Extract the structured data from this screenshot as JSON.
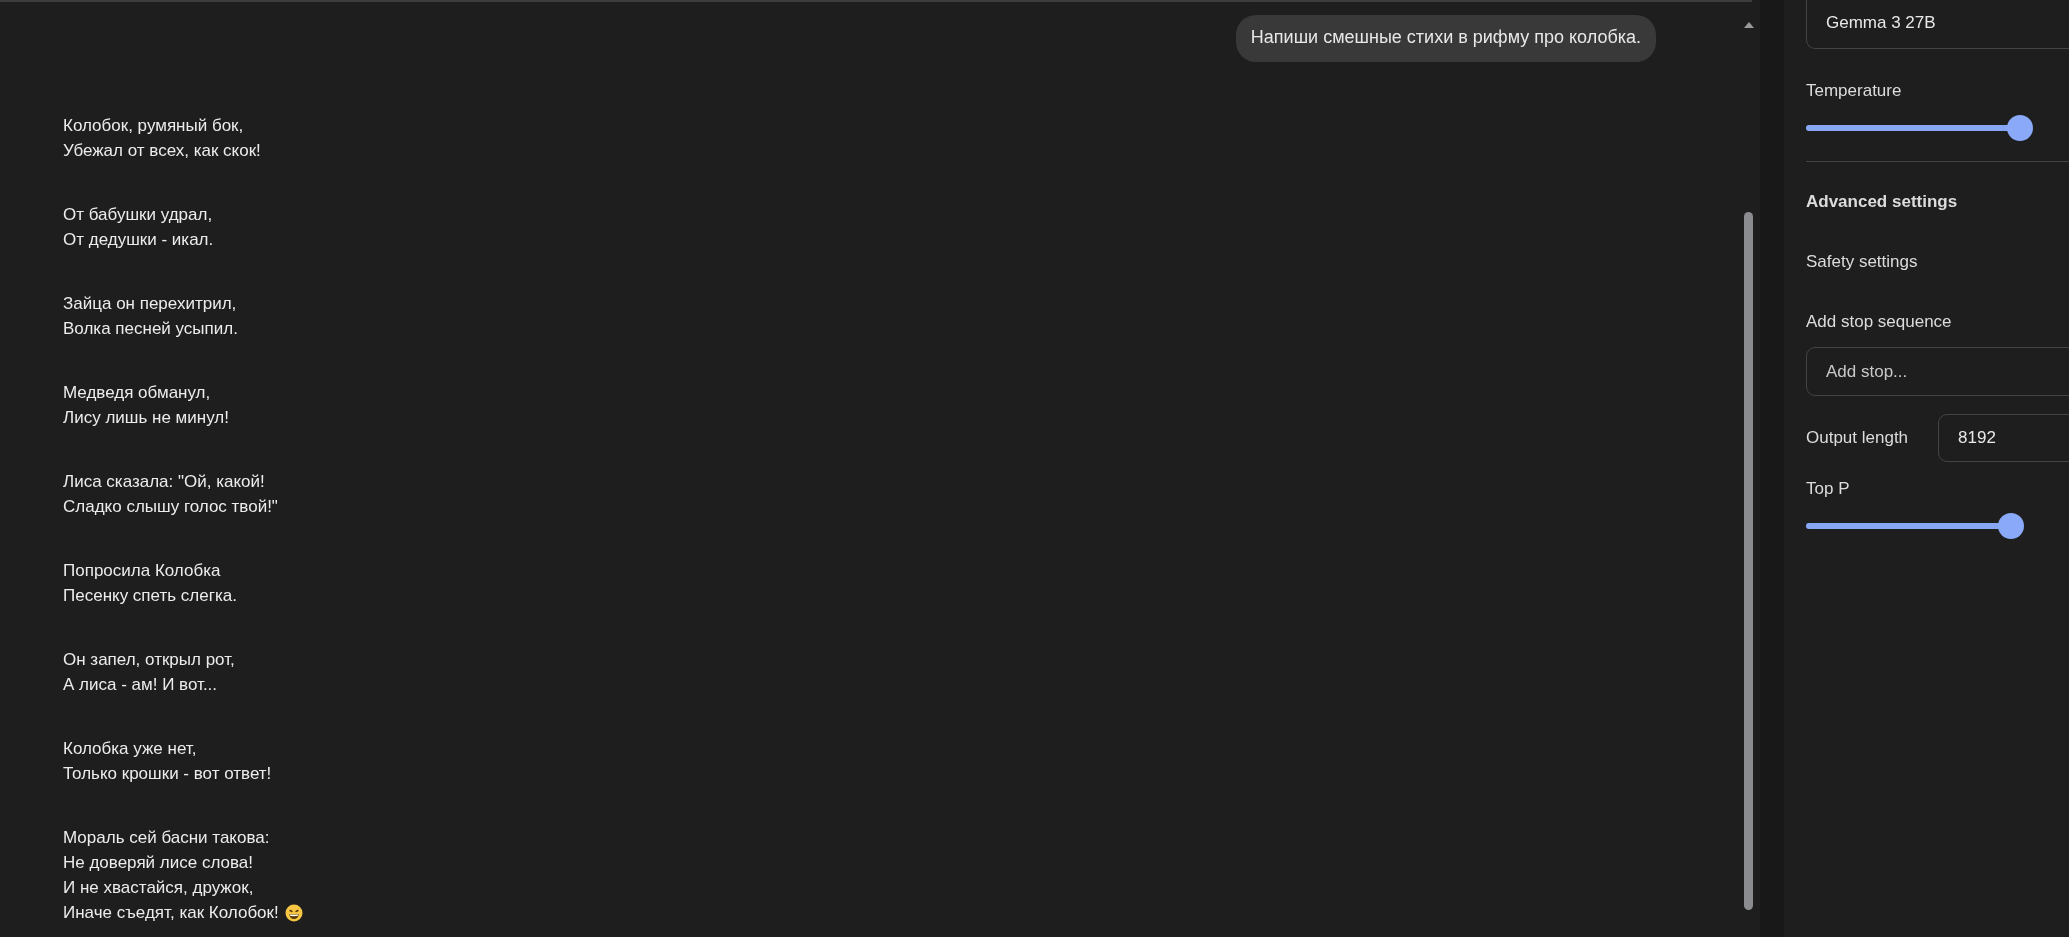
{
  "chat": {
    "user_message": "Напиши смешные стихи в рифму про колобка.",
    "response": {
      "stanzas": [
        [
          "Колобок, румяный бок,",
          "Убежал от всех, как скок!"
        ],
        [
          "От бабушки удрал,",
          "От дедушки - икал."
        ],
        [
          "Зайца он перехитрил,",
          "Волка песней усыпил."
        ],
        [
          "Медведя обманул,",
          "Лису лишь не минул!"
        ],
        [
          "Лиса сказала: \"Ой, какой!",
          "Сладко слышу голос твой!\""
        ],
        [
          "Попросила Колобка",
          "Песенку спеть слегка."
        ],
        [
          "Он запел, открыл рот,",
          "А лиса - ам! И вот..."
        ],
        [
          "Колобка уже нет,",
          "Только крошки - вот ответ!"
        ],
        [
          "Мораль сей басни такова:",
          "Не доверяй лисе слова!",
          "И не хвастайся, дружок,",
          "Иначе съедят, как Колобок!"
        ]
      ]
    }
  },
  "settings": {
    "model": "Gemma 3 27B",
    "temperature": {
      "label": "Temperature",
      "level": 1
    },
    "advanced_settings": "Advanced settings",
    "safety_settings": "Safety settings",
    "stop_sequence": {
      "label": "Add stop sequence",
      "placeholder": "Add stop..."
    },
    "output_length": {
      "label": "Output length",
      "value": "8192"
    },
    "top_p": {
      "label": "Top P",
      "level": 0.95
    }
  }
}
